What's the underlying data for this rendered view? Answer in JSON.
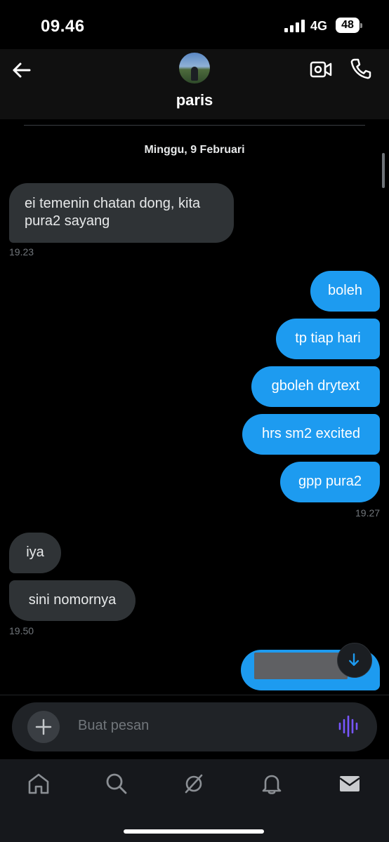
{
  "status": {
    "time": "09.46",
    "network": "4G",
    "battery": "48"
  },
  "header": {
    "contact_name": "paris"
  },
  "date_separator": "Minggu, 9 Februari",
  "messages": [
    {
      "text_line1": "ei temenin chatan dong, kita",
      "text_line2": "pura2 sayang",
      "timestamp": "19.23"
    },
    {
      "text": "boleh"
    },
    {
      "text": "tp tiap hari"
    },
    {
      "text": "gboleh drytext"
    },
    {
      "text": "hrs sm2 excited"
    },
    {
      "text": "gpp pura2",
      "timestamp": "19.27"
    },
    {
      "text": "iya"
    },
    {
      "text": "sini nomornya",
      "timestamp": "19.50"
    }
  ],
  "composer": {
    "placeholder": "Buat pesan"
  },
  "colors": {
    "sent_bubble": "#1d9bf0",
    "received_bubble": "#2f3336",
    "voice_icon": "#7856ff"
  },
  "icons": {
    "back": "arrow-left-icon",
    "video": "video-call-icon",
    "phone": "phone-icon",
    "scroll_down": "arrow-down-icon",
    "add": "plus-icon",
    "voice": "voice-wave-icon",
    "nav": [
      "home-icon",
      "search-icon",
      "grok-icon",
      "bell-icon",
      "mail-icon"
    ]
  }
}
